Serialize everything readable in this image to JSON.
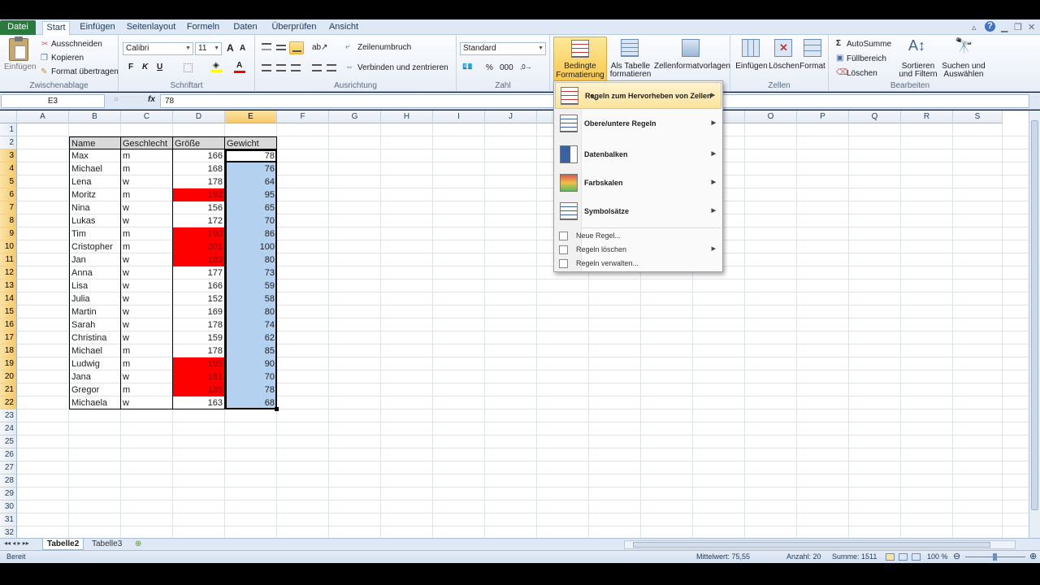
{
  "ribbon_tabs": [
    "Datei",
    "Start",
    "Einfügen",
    "Seitenlayout",
    "Formeln",
    "Daten",
    "Überprüfen",
    "Ansicht"
  ],
  "clipboard": {
    "paste": "Einfügen",
    "cut": "Ausschneiden",
    "copy": "Kopieren",
    "format_painter": "Format übertragen",
    "group": "Zwischenablage"
  },
  "font": {
    "name": "Calibri",
    "size": "11",
    "bold": "F",
    "italic": "K",
    "underline": "U",
    "group": "Schriftart"
  },
  "alignment": {
    "wrap": "Zeilenumbruch",
    "merge": "Verbinden und zentrieren",
    "group": "Ausrichtung"
  },
  "number": {
    "format": "Standard",
    "percent": "%",
    "thousands": "000",
    "group": "Zahl"
  },
  "styles": {
    "conditional_line1": "Bedingte",
    "conditional_line2": "Formatierung",
    "table_line1": "Als Tabelle",
    "table_line2": "formatieren",
    "cellstyles": "Zellenformatvorlagen"
  },
  "cells": {
    "insert": "Einfügen",
    "delete": "Löschen",
    "format": "Format",
    "group": "Zellen"
  },
  "editing": {
    "autosum": "AutoSumme",
    "fill": "Füllbereich",
    "clear": "Löschen",
    "sort_line1": "Sortieren",
    "sort_line2": "und Filtern",
    "find_line1": "Suchen und",
    "find_line2": "Auswählen",
    "group": "Bearbeiten"
  },
  "formula_bar": {
    "name_box": "E3",
    "fx": "fx",
    "value": "78"
  },
  "columns": [
    "A",
    "B",
    "C",
    "D",
    "E",
    "F",
    "G",
    "H",
    "I",
    "J",
    "K",
    "L",
    "M",
    "N",
    "O",
    "P",
    "Q",
    "R",
    "S"
  ],
  "rows": [
    "1",
    "2",
    "3",
    "4",
    "5",
    "6",
    "7",
    "8",
    "9",
    "10",
    "11",
    "12",
    "13",
    "14",
    "15",
    "16",
    "17",
    "18",
    "19",
    "20",
    "21",
    "22",
    "23",
    "24",
    "25",
    "26",
    "27",
    "28",
    "29",
    "30",
    "31",
    "32"
  ],
  "table": {
    "headers": [
      "Name",
      "Geschlecht",
      "Größe",
      "Gewicht"
    ],
    "rows": [
      {
        "name": "Max",
        "g": "m",
        "h": "166",
        "w": "78",
        "red": false
      },
      {
        "name": "Michael",
        "g": "m",
        "h": "168",
        "w": "76",
        "red": false
      },
      {
        "name": "Lena",
        "g": "w",
        "h": "178",
        "w": "64",
        "red": false
      },
      {
        "name": "Moritz",
        "g": "m",
        "h": "192",
        "w": "95",
        "red": true
      },
      {
        "name": "Nina",
        "g": "w",
        "h": "156",
        "w": "65",
        "red": false
      },
      {
        "name": "Lukas",
        "g": "w",
        "h": "172",
        "w": "70",
        "red": false
      },
      {
        "name": "Tim",
        "g": "m",
        "h": "190",
        "w": "86",
        "red": true
      },
      {
        "name": "Cristopher",
        "g": "m",
        "h": "201",
        "w": "100",
        "red": true
      },
      {
        "name": "Jan",
        "g": "w",
        "h": "189",
        "w": "80",
        "red": true
      },
      {
        "name": "Anna",
        "g": "w",
        "h": "177",
        "w": "73",
        "red": false
      },
      {
        "name": "Lisa",
        "g": "w",
        "h": "166",
        "w": "59",
        "red": false
      },
      {
        "name": "Julia",
        "g": "w",
        "h": "152",
        "w": "58",
        "red": false
      },
      {
        "name": "Martin",
        "g": "w",
        "h": "169",
        "w": "80",
        "red": false
      },
      {
        "name": "Sarah",
        "g": "w",
        "h": "178",
        "w": "74",
        "red": false
      },
      {
        "name": "Christina",
        "g": "w",
        "h": "159",
        "w": "62",
        "red": false
      },
      {
        "name": "Michael",
        "g": "m",
        "h": "178",
        "w": "85",
        "red": false
      },
      {
        "name": "Ludwig",
        "g": "m",
        "h": "195",
        "w": "90",
        "red": true
      },
      {
        "name": "Jana",
        "g": "w",
        "h": "181",
        "w": "70",
        "red": true
      },
      {
        "name": "Gregor",
        "g": "m",
        "h": "185",
        "w": "78",
        "red": true
      },
      {
        "name": "Michaela",
        "g": "w",
        "h": "163",
        "w": "68",
        "red": false
      }
    ]
  },
  "menu": {
    "items": [
      {
        "label": "Regeln zum Hervorheben von Zellen",
        "icon": "highlight-rules-icon"
      },
      {
        "label": "Obere/untere Regeln",
        "icon": "top-bottom-rules-icon"
      },
      {
        "label": "Datenbalken",
        "icon": "data-bars-icon"
      },
      {
        "label": "Farbskalen",
        "icon": "color-scales-icon"
      },
      {
        "label": "Symbolsätze",
        "icon": "icon-sets-icon"
      }
    ],
    "small_items": [
      {
        "label": "Neue Regel...",
        "icon": "new-rule-icon"
      },
      {
        "label": "Regeln löschen",
        "icon": "clear-rules-icon"
      },
      {
        "label": "Regeln verwalten...",
        "icon": "manage-rules-icon"
      }
    ]
  },
  "sheets": [
    "Tabelle2",
    "Tabelle3"
  ],
  "status": {
    "mode": "Bereit",
    "average": "Mittelwert: 75,55",
    "count": "Anzahl: 20",
    "sum": "Summe: 1511",
    "zoom": "100 %"
  },
  "colors": {
    "red_highlight": "#ff0000",
    "blue_selection": "#b4d2f0",
    "file_tab": "#2a7a3e",
    "active_header": "#f6c96a"
  }
}
